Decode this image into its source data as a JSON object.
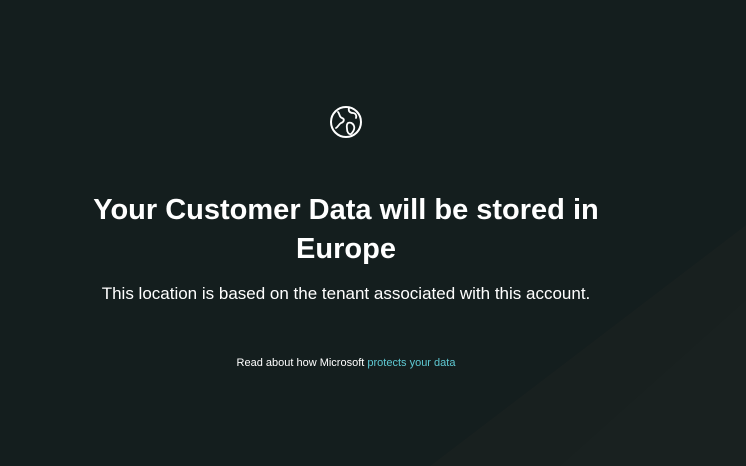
{
  "page": {
    "title_line": "Your Customer Data will be stored in Europe",
    "subtitle": "This location is based on the tenant associated with this account.",
    "footer_prefix": "Read about how Microsoft ",
    "footer_link": "protects your data",
    "icon": "globe-icon"
  },
  "colors": {
    "background": "#141e1e",
    "link": "#5fc9d3",
    "text": "#ffffff"
  }
}
